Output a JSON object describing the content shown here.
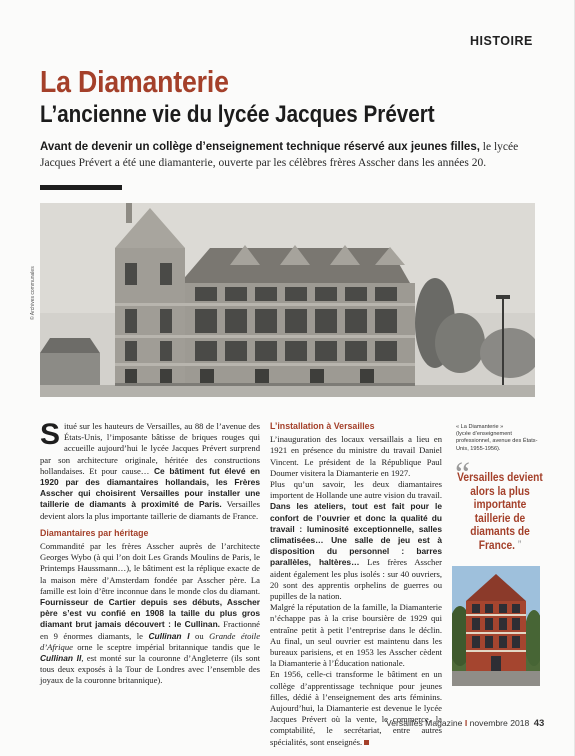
{
  "section": "HISTOIRE",
  "title": "La Diamanterie",
  "subtitle": "L’ancienne vie du lycée Jacques Prévert",
  "chapo": {
    "lead": "Avant de devenir un collège d’enseignement technique réservé aux jeunes filles,",
    "rest": " le lycée Jacques Prévert a été une diamanterie, ouverte par les célèbres frères Asscher dans les années 20."
  },
  "photo_credit": "© Archives communales",
  "col1": {
    "dropcap": "S",
    "p1": "itué sur les hauteurs de Versailles, au 88 de l’avenue des États-Unis, l’imposante bâtisse de briques rouges qui accueille aujourd’hui le lycée Jacques Prévert surprend par son architecture originale, héritée des constructions hollandaises. Et pour cause… ",
    "p1_bold": "Ce bâtiment fut élevé en 1920 par des diamantaires hollandais, les Frères Asscher qui choisirent Versailles pour installer une taillerie de diamants à proximité de Paris.",
    "p1_end": " Versailles devient alors la plus importante taillerie de diamants de France.",
    "subhead": "Diamantaires par héritage",
    "p2": "Commandité par les frères Asscher auprès de l’architecte Georges Wybo (à qui l’on doit Les Grands Moulins de Paris, le Printemps Haussmann…), le bâtiment est la réplique exacte de la maison mère d’Amsterdam fondée par Asscher père. La famille est loin d’être inconnue dans le monde clos du diamant. ",
    "p2_bold": "Fournisseur de Cartier depuis ses débuts, Asscher père s’est vu confié en 1908 la taille du plus gros diamant brut jamais découvert : le Cullinan.",
    "p2_end1": " Fractionné en 9 énormes diamants, le ",
    "p2_it1": "Cullinan I",
    "p2_end2": " ou ",
    "p2_it2": "Grande étoile d’Afrique",
    "p2_end3": " orne le sceptre impérial britannique tandis que le ",
    "p2_it3": "Cullinan II",
    "p2_end4": ", est monté sur la couronne d’Angleterre (ils sont tous deux exposés à la Tour de Londres avec l’ensemble des joyaux de la couronne britannique)."
  },
  "col2": {
    "subhead": "L’installation à Versailles",
    "p1": "L’inauguration des locaux versaillais a lieu en 1921 en présence du ministre du travail Daniel Vincent. Le président de la République Paul Doumer visitera la Diamanterie en 1927.",
    "p2a": "Plus qu’un savoir, les deux diamantaires importent de Hollande une autre vision du travail. ",
    "p2_bold": "Dans les ateliers, tout est fait pour le confort de l’ouvrier et donc la qualité du travail : luminosité exceptionnelle, salles climatisées… Une salle de jeu est à disposition du personnel : barres parallèles, haltères…",
    "p2b": " Les frères Asscher aident également les plus isolés : sur 40 ouvriers, 20 sont des apprentis orphelins de guerres ou pupilles de la nation.",
    "p3": "Malgré la réputation de la famille, la Diamanterie n’échappe pas à la crise boursière de 1929 qui entraîne petit à petit l’entreprise dans le déclin. Au final, un seul ouvrier est maintenu dans les bureaux parisiens, et en 1953 les Asscher cèdent la Diamanterie à l’Éducation nationale.",
    "p4": "En 1956, celle-ci transforme le bâtiment en un collège d’apprentissage technique pour jeunes filles, dédié à l’enseignement des arts féminins. Aujourd’hui, la Diamanterie est devenue le lycée Jacques Prévert où la vente, le commerce, la comptabilité, le secrétariat, entre autres spécialités, sont enseignés."
  },
  "caption": {
    "title": "« La Diamanterie »",
    "text": "(lycée d’enseignement professionnel, avenue des États-Unis, 1955-1956)."
  },
  "quote": {
    "open": "“",
    "text": "Versailles devient alors la plus importante taillerie de diamants de France.",
    "close": "”"
  },
  "footer": {
    "magazine": "Versailles Magazine",
    "separator": "I",
    "date": "novembre 2018",
    "page": "43"
  },
  "colors": {
    "accent": "#a4402a",
    "text": "#1e1e1e",
    "quote_mark": "#9a9a9a"
  }
}
